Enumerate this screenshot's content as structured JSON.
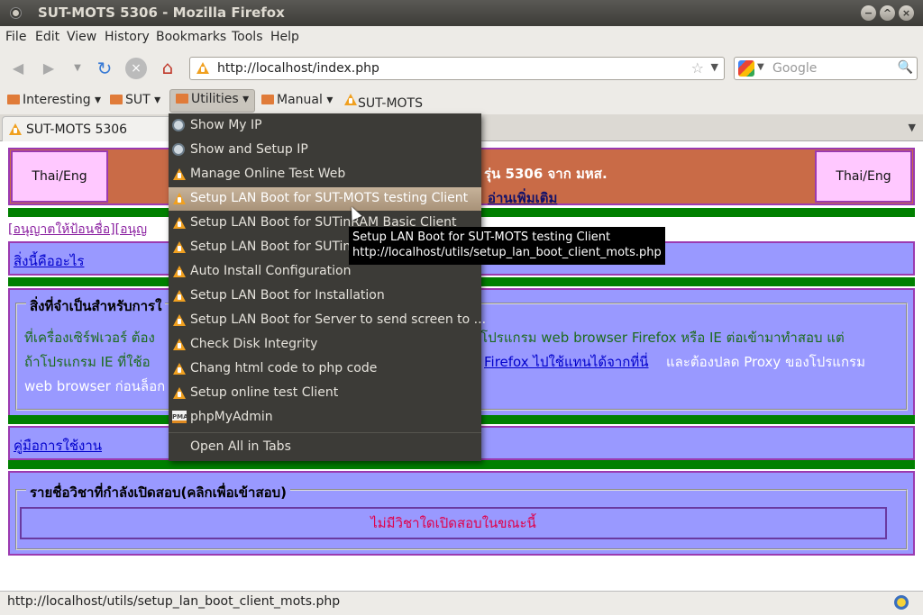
{
  "window": {
    "title": "SUT-MOTS 5306 - Mozilla Firefox"
  },
  "menubar": [
    "File",
    "Edit",
    "View",
    "History",
    "Bookmarks",
    "Tools",
    "Help"
  ],
  "navbar": {
    "url": "http://localhost/index.php",
    "search_placeholder": "Google"
  },
  "bookmarks": [
    {
      "label": "Interesting"
    },
    {
      "label": "SUT"
    },
    {
      "label": "Utilities"
    },
    {
      "label": "Manual"
    },
    {
      "label": "SUT-MOTS"
    }
  ],
  "tab": {
    "label": "SUT-MOTS 5306"
  },
  "page": {
    "thai_eng": "Thai/Eng",
    "banner_text": "รุ่น 5306 จาก มหส.",
    "banner_link": "อ่านเพิ่มเติม",
    "permit_text": "[อนุญาตให้ป้อนชื่อ][อนุญ",
    "what_is_link": "สิ่งนี้คืออะไร",
    "required_legend": "สิ่งที่จำเป็นสำหรับการใ",
    "req_line1_a": "ที่เครื่องเซิร์ฟเวอร์ ต้อง",
    "req_line1_b": "ช้โปรแกรม web browser Firefox หรือ IE ต่อเข้ามาทำสอบ แต่",
    "req_line2_a": "ถ้าโปรแกรม IE ที่ใช้อ",
    "req_line2_link": "Firefox ไปใช้แทนได้จากที่นี่",
    "req_line2_b": "และต้องปลด Proxy ของโปรแกรม",
    "req_line3": "web browser ก่อนล็อก",
    "manual_link": "คู่มือการใช้งาน",
    "courses_legend": "รายชื่อวิชาที่กำลังเปิดสอบ(คลิกเพื่อเข้าสอบ)",
    "no_exam": "ไม่มีวิชาใดเปิดสอบในขณะนี้"
  },
  "menu": {
    "items": [
      {
        "label": "Show My IP",
        "icon": "globe-icon"
      },
      {
        "label": "Show and Setup IP",
        "icon": "globe-icon"
      },
      {
        "label": "Manage Online Test Web",
        "icon": "vanilla-icon"
      },
      {
        "label": "Setup LAN Boot for SUT-MOTS testing Client",
        "icon": "vanilla-icon"
      },
      {
        "label": "Setup LAN Boot for SUTinRAM Basic Client",
        "icon": "vanilla-icon"
      },
      {
        "label": "Setup LAN Boot for SUTinR",
        "icon": "vanilla-icon"
      },
      {
        "label": "Auto Install Configuration",
        "icon": "vanilla-icon"
      },
      {
        "label": "Setup LAN Boot for Installation",
        "icon": "vanilla-icon"
      },
      {
        "label": "Setup LAN Boot for Server to send screen to ...",
        "icon": "vanilla-icon"
      },
      {
        "label": "Check Disk Integrity",
        "icon": "vanilla-icon"
      },
      {
        "label": "Chang html code to php code",
        "icon": "vanilla-icon"
      },
      {
        "label": "Setup online test Client",
        "icon": "vanilla-icon"
      },
      {
        "label": "phpMyAdmin",
        "icon": "phpmyadmin-icon"
      }
    ],
    "open_all": "Open All in Tabs"
  },
  "tooltip": {
    "title": "Setup LAN Boot for SUT-MOTS testing Client",
    "url": "http://localhost/utils/setup_lan_boot_client_mots.php"
  },
  "status": {
    "text": "http://localhost/utils/setup_lan_boot_client_mots.php"
  },
  "colors": {
    "accent": "#c96b47",
    "border": "#9b3ab0",
    "panel": "#9999ff",
    "green": "#008000"
  }
}
